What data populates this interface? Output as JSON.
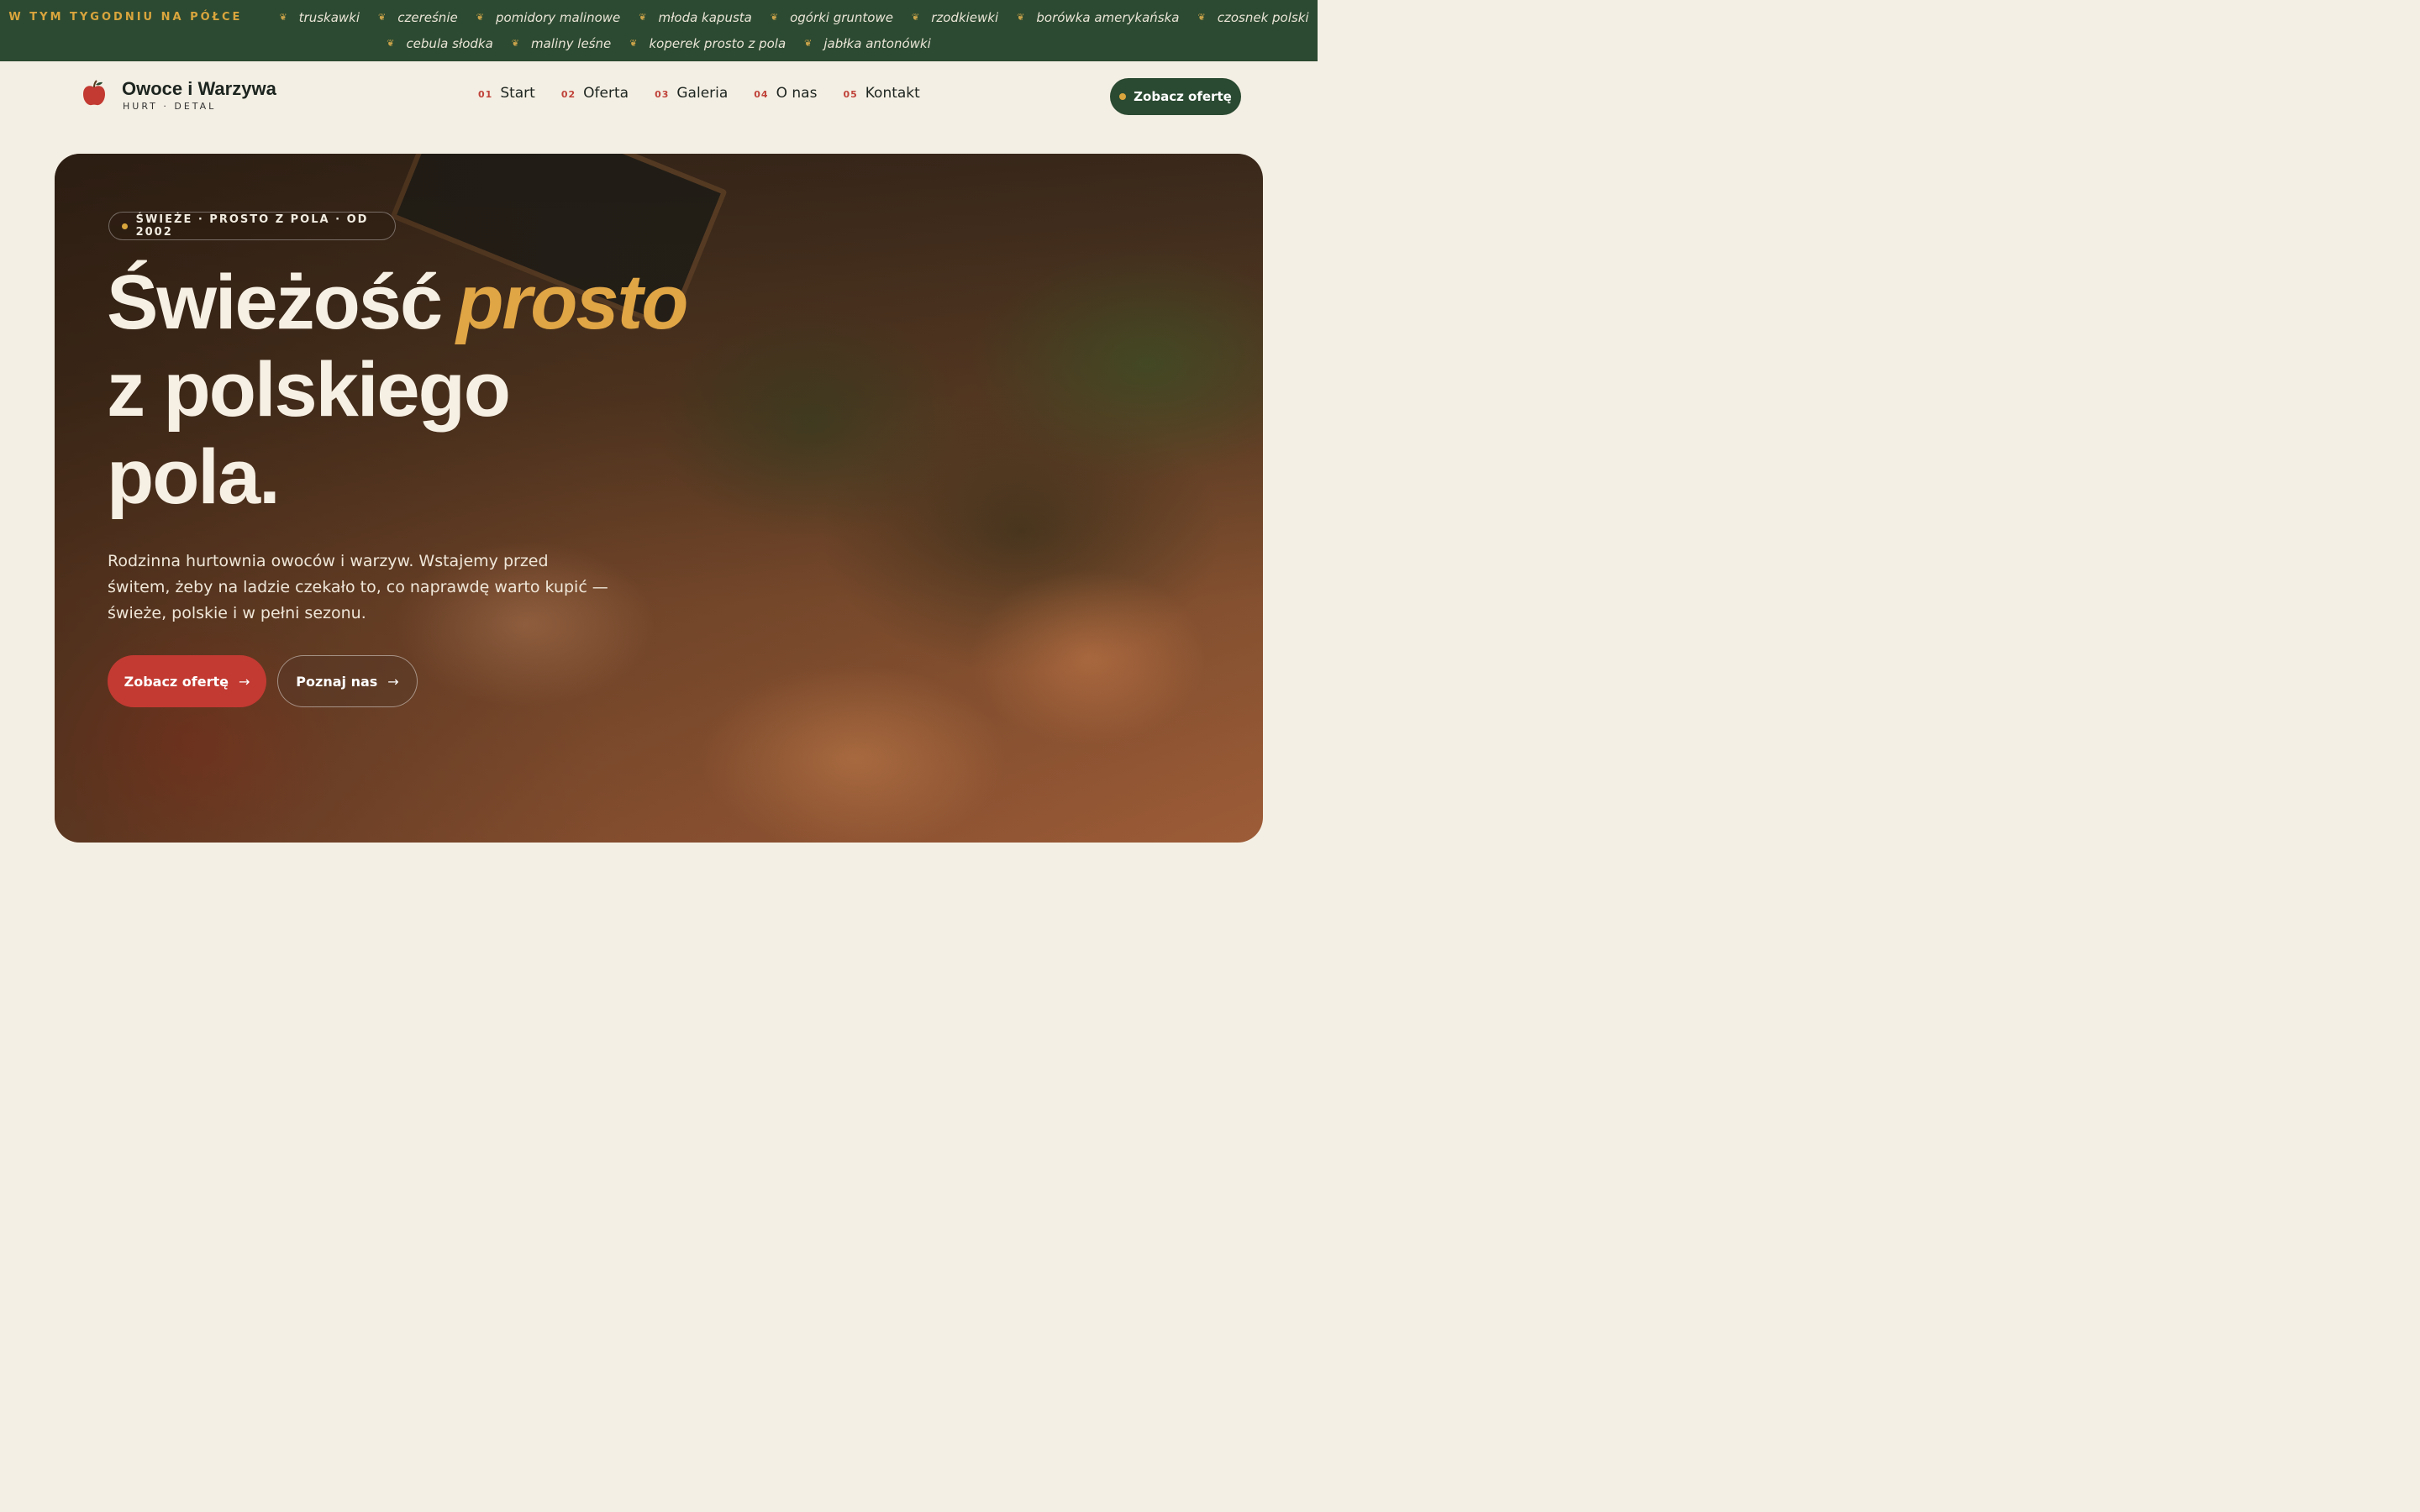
{
  "ticker": {
    "label": "W TYM TYGODNIU NA PÓŁCE",
    "row1": [
      "truskawki",
      "czereśnie",
      "pomidory malinowe",
      "młoda kapusta",
      "ogórki gruntowe",
      "rzodkiewki",
      "borówka amerykańska",
      "czosnek polski"
    ],
    "row2": [
      "cebula słodka",
      "maliny leśne",
      "koperek prosto z pola",
      "jabłka antonówki"
    ],
    "separator": "❦"
  },
  "brand": {
    "name": "Owoce i Warzywa",
    "tagline": "HURT · DETAL",
    "icon": "apple-icon"
  },
  "nav": [
    {
      "num": "01",
      "label": "Start"
    },
    {
      "num": "02",
      "label": "Oferta"
    },
    {
      "num": "03",
      "label": "Galeria"
    },
    {
      "num": "04",
      "label": "O nas"
    },
    {
      "num": "05",
      "label": "Kontakt"
    }
  ],
  "header_cta": "Zobacz ofertę",
  "hero": {
    "badge": "ŚWIEŻE · PROSTO Z POLA · OD 2002",
    "headline_line1": "Świeżość",
    "headline_accent": "prosto",
    "headline_line2": "z polskiego",
    "headline_line3": "pola.",
    "lead": "Rodzinna hurtownia owoców i warzyw. Wstajemy przed świtem, żeby na ladzie czekało to, co naprawdę warto kupić — świeże, polskie i w pełni sezonu.",
    "primary_button": "Zobacz ofertę",
    "secondary_button": "Poznaj nas",
    "arrow": "→"
  },
  "colors": {
    "ticker_bg": "#2c4a31",
    "accent_gold": "#d9a53d",
    "accent_red": "#c23a32",
    "page_bg": "#f4efe4"
  }
}
